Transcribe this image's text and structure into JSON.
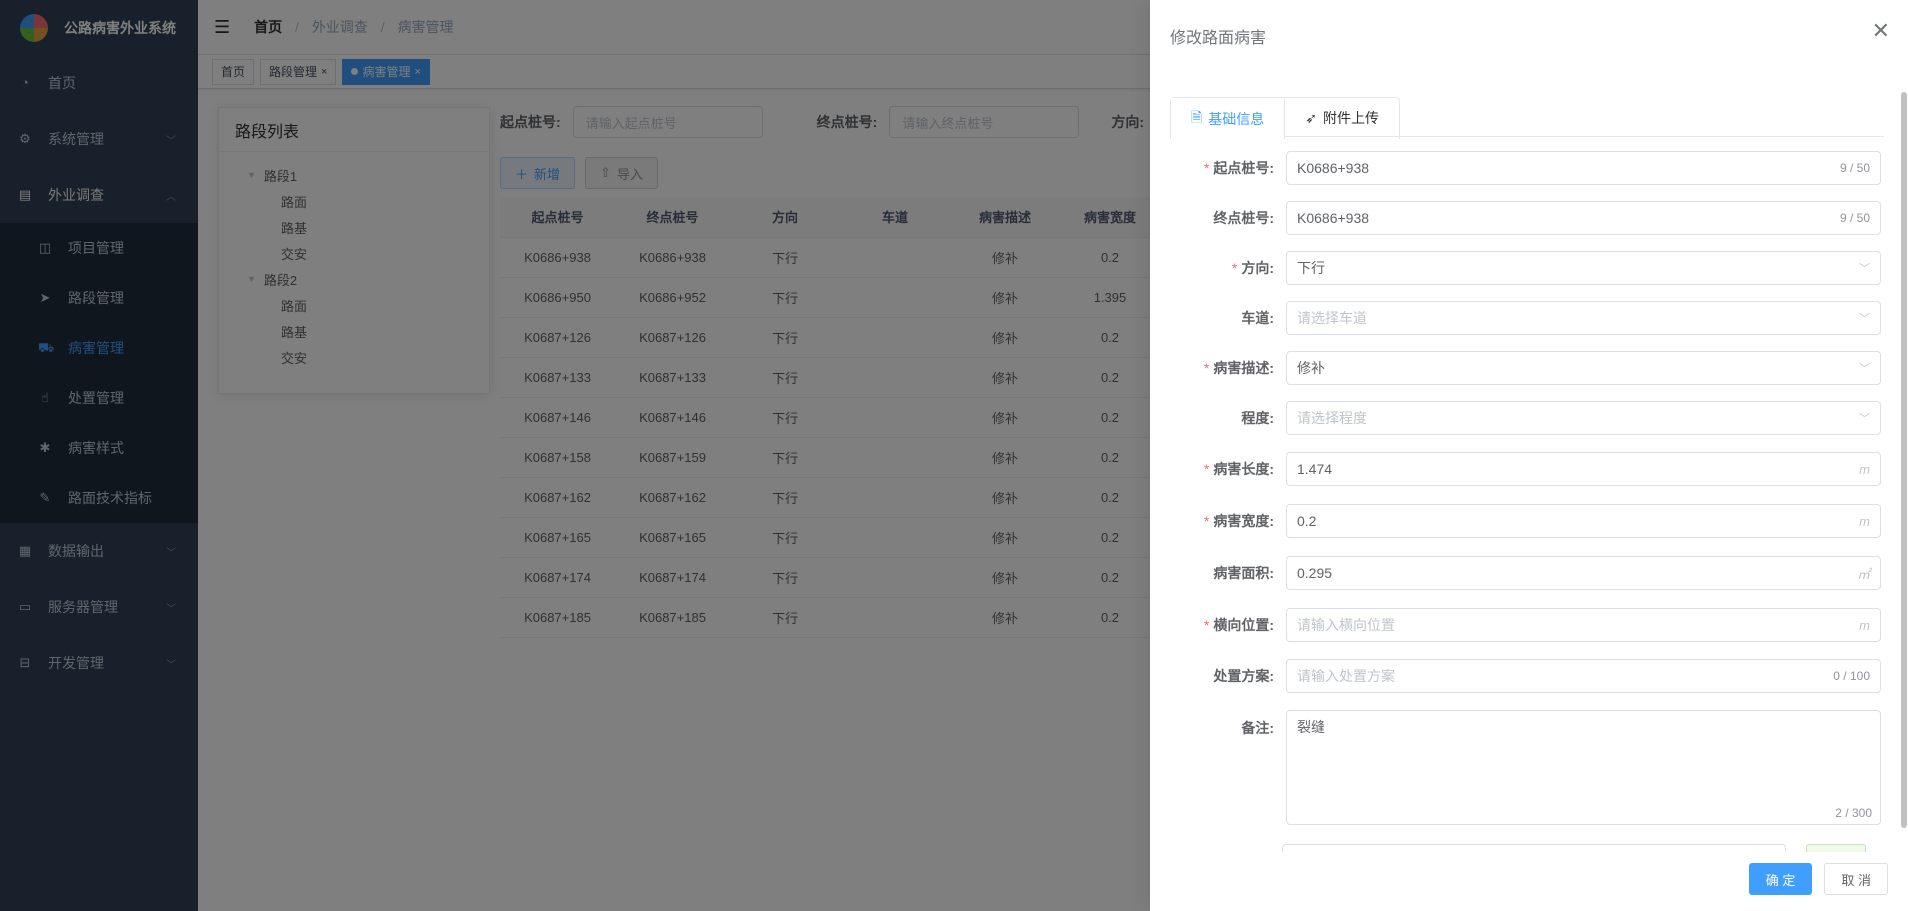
{
  "app": {
    "title": "公路病害外业系统"
  },
  "sidebar": {
    "items": [
      {
        "label": "首页",
        "icon": "dashboard-icon"
      },
      {
        "label": "系统管理",
        "icon": "gear-icon"
      },
      {
        "label": "外业调查",
        "icon": "document-icon"
      },
      {
        "label": "数据输出",
        "icon": "export-icon"
      },
      {
        "label": "服务器管理",
        "icon": "monitor-icon"
      },
      {
        "label": "开发管理",
        "icon": "toolbox-icon"
      }
    ],
    "sub_items": [
      {
        "label": "项目管理",
        "icon": "book-icon"
      },
      {
        "label": "路段管理",
        "icon": "send-icon"
      },
      {
        "label": "病害管理",
        "icon": "car-icon"
      },
      {
        "label": "处置管理",
        "icon": "hand-icon"
      },
      {
        "label": "病害样式",
        "icon": "bug-icon"
      },
      {
        "label": "路面技术指标",
        "icon": "edit-doc-icon"
      }
    ],
    "active_color": "#409eff"
  },
  "breadcrumb": {
    "items": [
      "首页",
      "外业调查",
      "病害管理"
    ]
  },
  "tags": [
    {
      "label": "首页"
    },
    {
      "label": "路段管理"
    },
    {
      "label": "病害管理"
    }
  ],
  "tree": {
    "title": "路段列表",
    "nodes": [
      {
        "label": "路段1",
        "children": [
          "路面",
          "路基",
          "交安"
        ]
      },
      {
        "label": "路段2",
        "children": [
          "路面",
          "路基",
          "交安"
        ]
      }
    ]
  },
  "filter": {
    "start_label": "起点桩号:",
    "start_placeholder": "请输入起点桩号",
    "end_label": "终点桩号:",
    "end_placeholder": "请输入终点桩号",
    "direction_label": "方向:"
  },
  "toolbar": {
    "add_label": "新增",
    "import_label": "导入"
  },
  "table": {
    "headers": [
      "起点桩号",
      "终点桩号",
      "方向",
      "车道",
      "病害描述",
      "病害宽度"
    ],
    "rows": [
      [
        "K0686+938",
        "K0686+938",
        "下行",
        "",
        "修补",
        "0.2"
      ],
      [
        "K0686+950",
        "K0686+952",
        "下行",
        "",
        "修补",
        "1.395"
      ],
      [
        "K0687+126",
        "K0687+126",
        "下行",
        "",
        "修补",
        "0.2"
      ],
      [
        "K0687+133",
        "K0687+133",
        "下行",
        "",
        "修补",
        "0.2"
      ],
      [
        "K0687+146",
        "K0687+146",
        "下行",
        "",
        "修补",
        "0.2"
      ],
      [
        "K0687+158",
        "K0687+159",
        "下行",
        "",
        "修补",
        "0.2"
      ],
      [
        "K0687+162",
        "K0687+162",
        "下行",
        "",
        "修补",
        "0.2"
      ],
      [
        "K0687+165",
        "K0687+165",
        "下行",
        "",
        "修补",
        "0.2"
      ],
      [
        "K0687+174",
        "K0687+174",
        "下行",
        "",
        "修补",
        "0.2"
      ],
      [
        "K0687+185",
        "K0687+185",
        "下行",
        "",
        "修补",
        "0.2"
      ]
    ]
  },
  "drawer": {
    "title": "修改路面病害",
    "tabs": [
      {
        "label": "基础信息",
        "icon": "doc-icon"
      },
      {
        "label": "附件上传",
        "icon": "navigation-icon"
      }
    ],
    "fields": {
      "start": {
        "label": "起点桩号:",
        "value": "K0686+938",
        "count": "9 / 50"
      },
      "end": {
        "label": "终点桩号:",
        "value": "K0686+938",
        "count": "9 / 50"
      },
      "direction": {
        "label": "方向:",
        "value": "下行"
      },
      "lane": {
        "label": "车道:",
        "placeholder": "请选择车道"
      },
      "desc": {
        "label": "病害描述:",
        "value": "修补"
      },
      "degree": {
        "label": "程度:",
        "placeholder": "请选择程度"
      },
      "length": {
        "label": "病害长度:",
        "value": "1.474",
        "unit": "m"
      },
      "width": {
        "label": "病害宽度:",
        "value": "0.2",
        "unit": "m"
      },
      "area": {
        "label": "病害面积:",
        "value": "0.295",
        "unit": "㎡"
      },
      "lateral": {
        "label": "横向位置:",
        "placeholder": "请输入横向位置",
        "unit": "m"
      },
      "plan": {
        "label": "处置方案:",
        "placeholder": "请输入处置方案",
        "count": "0 / 100"
      },
      "remark": {
        "label": "备注:",
        "value": "裂缝",
        "count": "2 / 300"
      }
    },
    "confirm_label": "确 定",
    "cancel_label": "取 消"
  }
}
